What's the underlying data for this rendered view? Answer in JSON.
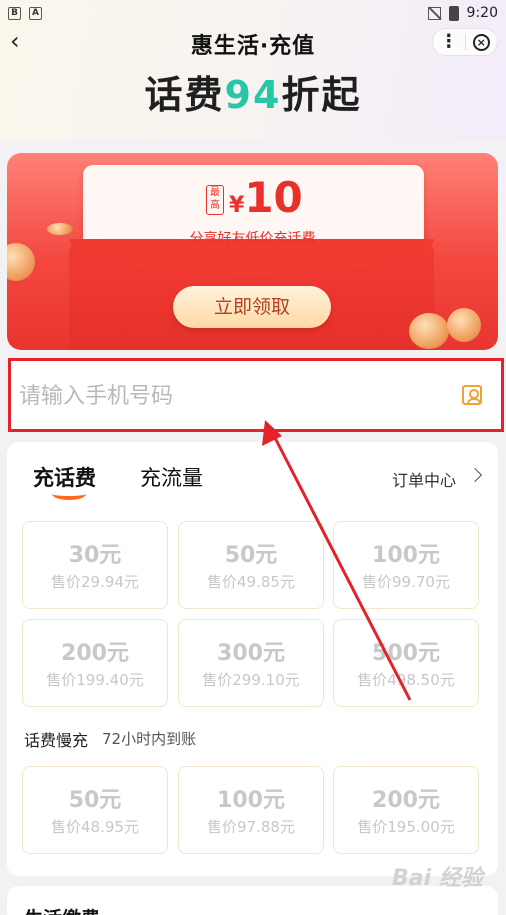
{
  "status_bar": {
    "time": "9:20",
    "left_icon_1": "B",
    "left_icon_2": "A"
  },
  "header": {
    "title": "惠生活·充值",
    "back_icon": "chevron-left-icon",
    "more_icon": "more-icon",
    "close_icon": "close-icon",
    "slogan_prefix": "话费",
    "slogan_highlight": "94",
    "slogan_suffix": "折起"
  },
  "banner": {
    "badge": "最高",
    "currency": "¥",
    "amount": "10",
    "subtitle": "分享好友低价充话费",
    "button_label": "立即领取"
  },
  "phone_input": {
    "placeholder": "请输入手机号码",
    "value": "",
    "contact_icon": "contacts-icon"
  },
  "tabs": {
    "call": "充话费",
    "data": "充流量",
    "orders": "订单中心"
  },
  "recharge_options": [
    {
      "face": "30元",
      "price": "售价29.94元"
    },
    {
      "face": "50元",
      "price": "售价49.85元"
    },
    {
      "face": "100元",
      "price": "售价99.70元"
    },
    {
      "face": "200元",
      "price": "售价199.40元"
    },
    {
      "face": "300元",
      "price": "售价299.10元"
    },
    {
      "face": "500元",
      "price": "售价498.50元"
    }
  ],
  "slow_recharge": {
    "label": "话费慢充",
    "sublabel": "72小时内到账",
    "options": [
      {
        "face": "50元",
        "price": "售价48.95元"
      },
      {
        "face": "100元",
        "price": "售价97.88元"
      },
      {
        "face": "200元",
        "price": "售价195.00元"
      }
    ]
  },
  "bottom_section": {
    "title": "生活缴费"
  },
  "watermark": "Bai 经验",
  "colors": {
    "accent_green": "#27c6a6",
    "banner_red": "#f3473f",
    "highlight_border": "#e4222a",
    "tab_underline": "#fb6a1f"
  }
}
